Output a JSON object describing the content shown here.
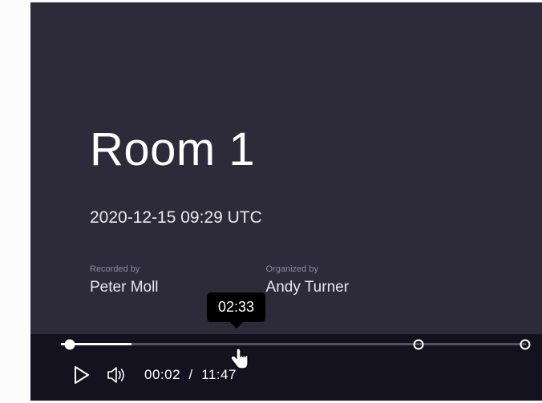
{
  "video": {
    "title": "Room 1",
    "timestamp": "2020-12-15 09:29 UTC",
    "recorded_by_label": "Recorded by",
    "recorded_by_name": "Peter Moll",
    "organized_by_label": "Organized by",
    "organized_by_name": "Andy Turner"
  },
  "player": {
    "tooltip_time": "02:33",
    "current_time": "00:02",
    "separator": "/",
    "total_time": "11:47"
  }
}
